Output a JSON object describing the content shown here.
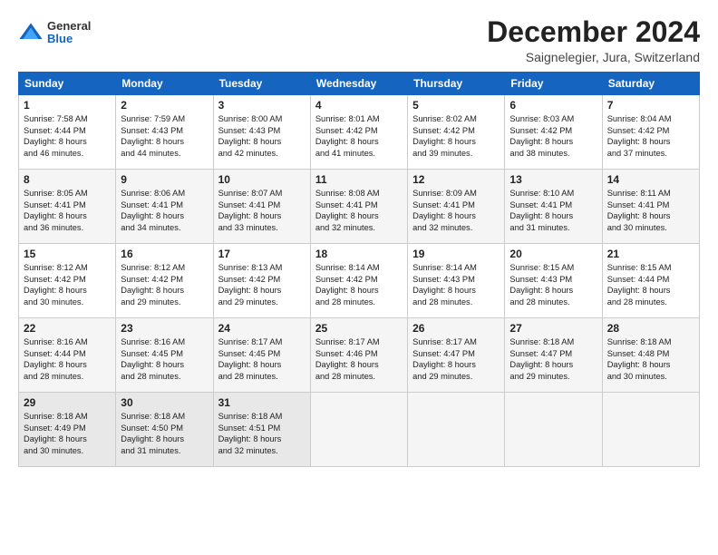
{
  "logo": {
    "general": "General",
    "blue": "Blue"
  },
  "header": {
    "month": "December 2024",
    "location": "Saignelegier, Jura, Switzerland"
  },
  "weekdays": [
    "Sunday",
    "Monday",
    "Tuesday",
    "Wednesday",
    "Thursday",
    "Friday",
    "Saturday"
  ],
  "weeks": [
    [
      {
        "day": "1",
        "text": "Sunrise: 7:58 AM\nSunset: 4:44 PM\nDaylight: 8 hours\nand 46 minutes."
      },
      {
        "day": "2",
        "text": "Sunrise: 7:59 AM\nSunset: 4:43 PM\nDaylight: 8 hours\nand 44 minutes."
      },
      {
        "day": "3",
        "text": "Sunrise: 8:00 AM\nSunset: 4:43 PM\nDaylight: 8 hours\nand 42 minutes."
      },
      {
        "day": "4",
        "text": "Sunrise: 8:01 AM\nSunset: 4:42 PM\nDaylight: 8 hours\nand 41 minutes."
      },
      {
        "day": "5",
        "text": "Sunrise: 8:02 AM\nSunset: 4:42 PM\nDaylight: 8 hours\nand 39 minutes."
      },
      {
        "day": "6",
        "text": "Sunrise: 8:03 AM\nSunset: 4:42 PM\nDaylight: 8 hours\nand 38 minutes."
      },
      {
        "day": "7",
        "text": "Sunrise: 8:04 AM\nSunset: 4:42 PM\nDaylight: 8 hours\nand 37 minutes."
      }
    ],
    [
      {
        "day": "8",
        "text": "Sunrise: 8:05 AM\nSunset: 4:41 PM\nDaylight: 8 hours\nand 36 minutes."
      },
      {
        "day": "9",
        "text": "Sunrise: 8:06 AM\nSunset: 4:41 PM\nDaylight: 8 hours\nand 34 minutes."
      },
      {
        "day": "10",
        "text": "Sunrise: 8:07 AM\nSunset: 4:41 PM\nDaylight: 8 hours\nand 33 minutes."
      },
      {
        "day": "11",
        "text": "Sunrise: 8:08 AM\nSunset: 4:41 PM\nDaylight: 8 hours\nand 32 minutes."
      },
      {
        "day": "12",
        "text": "Sunrise: 8:09 AM\nSunset: 4:41 PM\nDaylight: 8 hours\nand 32 minutes."
      },
      {
        "day": "13",
        "text": "Sunrise: 8:10 AM\nSunset: 4:41 PM\nDaylight: 8 hours\nand 31 minutes."
      },
      {
        "day": "14",
        "text": "Sunrise: 8:11 AM\nSunset: 4:41 PM\nDaylight: 8 hours\nand 30 minutes."
      }
    ],
    [
      {
        "day": "15",
        "text": "Sunrise: 8:12 AM\nSunset: 4:42 PM\nDaylight: 8 hours\nand 30 minutes."
      },
      {
        "day": "16",
        "text": "Sunrise: 8:12 AM\nSunset: 4:42 PM\nDaylight: 8 hours\nand 29 minutes."
      },
      {
        "day": "17",
        "text": "Sunrise: 8:13 AM\nSunset: 4:42 PM\nDaylight: 8 hours\nand 29 minutes."
      },
      {
        "day": "18",
        "text": "Sunrise: 8:14 AM\nSunset: 4:42 PM\nDaylight: 8 hours\nand 28 minutes."
      },
      {
        "day": "19",
        "text": "Sunrise: 8:14 AM\nSunset: 4:43 PM\nDaylight: 8 hours\nand 28 minutes."
      },
      {
        "day": "20",
        "text": "Sunrise: 8:15 AM\nSunset: 4:43 PM\nDaylight: 8 hours\nand 28 minutes."
      },
      {
        "day": "21",
        "text": "Sunrise: 8:15 AM\nSunset: 4:44 PM\nDaylight: 8 hours\nand 28 minutes."
      }
    ],
    [
      {
        "day": "22",
        "text": "Sunrise: 8:16 AM\nSunset: 4:44 PM\nDaylight: 8 hours\nand 28 minutes."
      },
      {
        "day": "23",
        "text": "Sunrise: 8:16 AM\nSunset: 4:45 PM\nDaylight: 8 hours\nand 28 minutes."
      },
      {
        "day": "24",
        "text": "Sunrise: 8:17 AM\nSunset: 4:45 PM\nDaylight: 8 hours\nand 28 minutes."
      },
      {
        "day": "25",
        "text": "Sunrise: 8:17 AM\nSunset: 4:46 PM\nDaylight: 8 hours\nand 28 minutes."
      },
      {
        "day": "26",
        "text": "Sunrise: 8:17 AM\nSunset: 4:47 PM\nDaylight: 8 hours\nand 29 minutes."
      },
      {
        "day": "27",
        "text": "Sunrise: 8:18 AM\nSunset: 4:47 PM\nDaylight: 8 hours\nand 29 minutes."
      },
      {
        "day": "28",
        "text": "Sunrise: 8:18 AM\nSunset: 4:48 PM\nDaylight: 8 hours\nand 30 minutes."
      }
    ],
    [
      {
        "day": "29",
        "text": "Sunrise: 8:18 AM\nSunset: 4:49 PM\nDaylight: 8 hours\nand 30 minutes."
      },
      {
        "day": "30",
        "text": "Sunrise: 8:18 AM\nSunset: 4:50 PM\nDaylight: 8 hours\nand 31 minutes."
      },
      {
        "day": "31",
        "text": "Sunrise: 8:18 AM\nSunset: 4:51 PM\nDaylight: 8 hours\nand 32 minutes."
      },
      {
        "day": "",
        "text": ""
      },
      {
        "day": "",
        "text": ""
      },
      {
        "day": "",
        "text": ""
      },
      {
        "day": "",
        "text": ""
      }
    ]
  ]
}
